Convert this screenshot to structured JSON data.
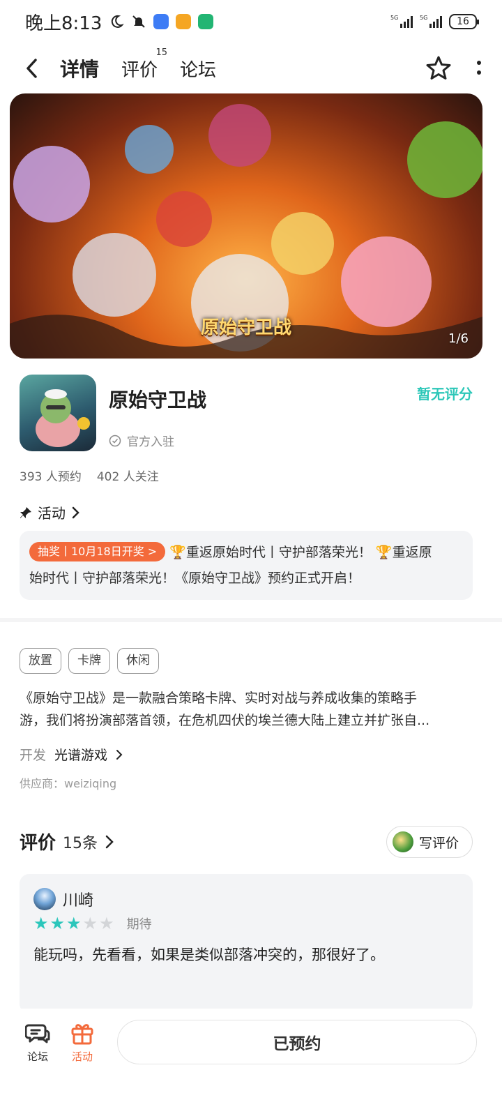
{
  "status_bar": {
    "time": "晚上8:13",
    "network_1": "5G",
    "network_2": "5G",
    "battery": "16"
  },
  "nav": {
    "tabs": [
      {
        "label": "详情",
        "active": true
      },
      {
        "label": "评价",
        "badge": "15"
      },
      {
        "label": "论坛"
      }
    ]
  },
  "banner": {
    "counter": "1/6",
    "logo_text": "原始守卫战"
  },
  "game": {
    "title": "原始守卫战",
    "official_label": "官方入驻",
    "rating_text": "暂无评分",
    "reservations": "393 人预约",
    "followers": "402 人关注"
  },
  "activity": {
    "title": "活动",
    "tag": "抽奖丨10月18日开奖 >",
    "text_line1": "🏆重返原始时代丨守护部落荣光！ 🏆重返原",
    "text_line2": "始时代丨守护部落荣光！《原始守卫战》预约正式开启！"
  },
  "tags": [
    "放置",
    "卡牌",
    "休闲"
  ],
  "description": {
    "line1": "《原始守卫战》是一款融合策略卡牌、实时对战与养成收集的策略手",
    "line2": "游，我们将扮演部落首领，在危机四伏的埃兰德大陆上建立并扩张自..."
  },
  "developer": {
    "label": "开发",
    "name": "光谱游戏",
    "supplier": "供应商：weiziqing"
  },
  "reviews": {
    "title": "评价",
    "count": "15条",
    "write_button": "写评价",
    "items": [
      {
        "user": "川崎",
        "stars": 3,
        "max_stars": 5,
        "label": "期待",
        "text": "能玩吗，先看看，如果是类似部落冲突的，那很好了。"
      }
    ]
  },
  "bottom_bar": {
    "forum_label": "论坛",
    "activity_label": "活动",
    "reserve_button": "已预约"
  },
  "colors": {
    "accent": "#2cc7b8",
    "orange": "#f36a3b",
    "card_bg": "#f3f4f6"
  }
}
